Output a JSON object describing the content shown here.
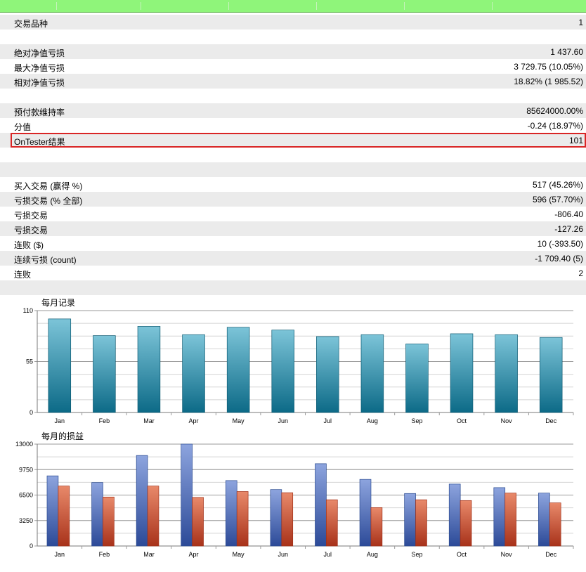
{
  "stats": [
    {
      "label": "交易品种",
      "value": "1",
      "shade": true
    },
    {
      "label": "",
      "value": "",
      "shade": false
    },
    {
      "label": "绝对净值亏损",
      "value": "1 437.60",
      "shade": true
    },
    {
      "label": "最大净值亏损",
      "value": "3 729.75 (10.05%)",
      "shade": false
    },
    {
      "label": "相对净值亏损",
      "value": "18.82% (1 985.52)",
      "shade": true
    },
    {
      "label": "",
      "value": "",
      "shade": false
    },
    {
      "label": "预付款维持率",
      "value": "85624000.00%",
      "shade": true
    },
    {
      "label": "分值",
      "value": "-0.24 (18.97%)",
      "shade": false
    },
    {
      "label": "OnTester结果",
      "value": "101",
      "shade": true,
      "highlight": true
    },
    {
      "label": "",
      "value": "",
      "shade": false
    },
    {
      "label": "",
      "value": "",
      "shade": true
    },
    {
      "label": "买入交易 (赢得 %)",
      "value": "517 (45.26%)",
      "shade": false
    },
    {
      "label": "亏损交易 (% 全部)",
      "value": "596 (57.70%)",
      "shade": true
    },
    {
      "label": "亏损交易",
      "value": "-806.40",
      "shade": false
    },
    {
      "label": "亏损交易",
      "value": "-127.26",
      "shade": true
    },
    {
      "label": "连败 ($)",
      "value": "10 (-393.50)",
      "shade": false
    },
    {
      "label": "连续亏损 (count)",
      "value": "-1 709.40 (5)",
      "shade": true
    },
    {
      "label": "连败",
      "value": "2",
      "shade": false
    },
    {
      "label": "",
      "value": "",
      "shade": true
    }
  ],
  "chart_data": [
    {
      "type": "bar",
      "title": "每月记录",
      "categories": [
        "Jan",
        "Feb",
        "Mar",
        "Apr",
        "May",
        "Jun",
        "Jul",
        "Aug",
        "Sep",
        "Oct",
        "Nov",
        "Dec"
      ],
      "series": [
        {
          "values": [
            101,
            83,
            93,
            84,
            92,
            89,
            82,
            84,
            74,
            85,
            84,
            81
          ]
        }
      ],
      "ylim": [
        0,
        110
      ],
      "yticks": [
        0,
        55,
        110
      ],
      "grid": true,
      "colors": {
        "top": "#7cc4d8",
        "bottom": "#0c6a87",
        "edge": "#0e5b73"
      }
    },
    {
      "type": "bar",
      "title": "每月的损益",
      "categories": [
        "Jan",
        "Feb",
        "Mar",
        "Apr",
        "May",
        "Jun",
        "Jul",
        "Aug",
        "Sep",
        "Oct",
        "Nov",
        "Dec"
      ],
      "series": [
        {
          "values": [
            8950,
            8100,
            11550,
            13000,
            8350,
            7200,
            10500,
            8500,
            6700,
            7900,
            7450,
            6750
          ]
        },
        {
          "values": [
            7650,
            6250,
            7650,
            6200,
            6950,
            6800,
            5900,
            4900,
            5900,
            5800,
            6750,
            5500
          ]
        }
      ],
      "ylim": [
        0,
        13000
      ],
      "yticks": [
        0,
        3250,
        6500,
        9750,
        13000
      ],
      "grid": true,
      "colors": [
        {
          "top": "#8da4de",
          "bottom": "#2c4a98",
          "edge": "#2a4a90"
        },
        {
          "top": "#e8896a",
          "bottom": "#a8321a",
          "edge": "#a03018"
        }
      ]
    }
  ]
}
